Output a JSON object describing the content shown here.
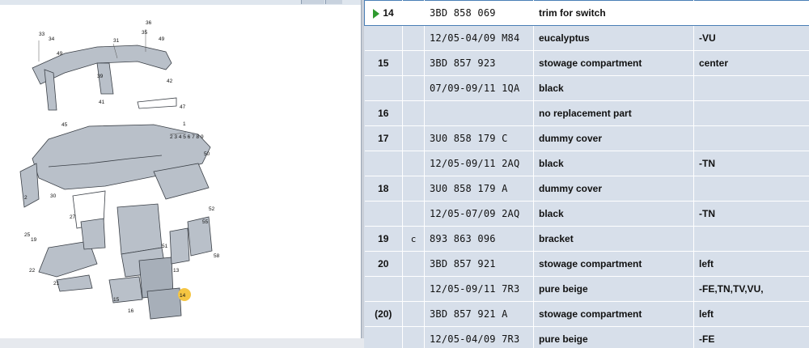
{
  "diagram": {
    "callout_labels": [
      "1",
      "2 3 4 5 6 7 8 9",
      "4",
      "5",
      "6",
      "7",
      "8",
      "9",
      "10",
      "11",
      "12",
      "13",
      "15",
      "16",
      "17",
      "19",
      "21",
      "22",
      "23",
      "24",
      "25",
      "26",
      "27",
      "28",
      "29",
      "30",
      "31",
      "33",
      "34",
      "35",
      "36",
      "37",
      "38",
      "40",
      "41",
      "42",
      "43",
      "44",
      "45",
      "46",
      "47",
      "48",
      "49",
      "50",
      "51",
      "52",
      "53",
      "54",
      "55",
      "56",
      "57",
      "58",
      "59",
      "60"
    ],
    "highlight_label": "14",
    "highlight_color": "#f5c542"
  },
  "table": {
    "rows": [
      {
        "pos": "14",
        "ind": "",
        "part": "3BD  858  069",
        "desc": "trim for switch",
        "remark": "",
        "selected": true
      },
      {
        "pos": "",
        "ind": "",
        "part": "12/05-04/09 M84",
        "desc": "eucalyptus",
        "remark": "-VU"
      },
      {
        "pos": "15",
        "ind": "",
        "part": "3BD  857  923",
        "desc": "stowage compartment",
        "remark": "center"
      },
      {
        "pos": "",
        "ind": "",
        "part": "07/09-09/11 1QA",
        "desc": "black",
        "remark": ""
      },
      {
        "pos": "16",
        "ind": "",
        "part": "",
        "desc": "no replacement part",
        "remark": ""
      },
      {
        "pos": "17",
        "ind": "",
        "part": "3U0  858  179  C",
        "desc": "dummy cover",
        "remark": ""
      },
      {
        "pos": "",
        "ind": "",
        "part": "12/05-09/11 2AQ",
        "desc": "black",
        "remark": "-TN"
      },
      {
        "pos": "18",
        "ind": "",
        "part": "3U0  858  179  A",
        "desc": "dummy cover",
        "remark": ""
      },
      {
        "pos": "",
        "ind": "",
        "part": "12/05-07/09 2AQ",
        "desc": "black",
        "remark": "-TN"
      },
      {
        "pos": "19",
        "ind": "c",
        "part": "893  863  096",
        "desc": "bracket",
        "remark": ""
      },
      {
        "pos": "20",
        "ind": "",
        "part": "3BD  857  921",
        "desc": "stowage compartment",
        "remark": "left"
      },
      {
        "pos": "",
        "ind": "",
        "part": "12/05-09/11 7R3",
        "desc": "pure beige",
        "remark": "-FE,TN,TV,VU,"
      },
      {
        "pos": "(20)",
        "ind": "",
        "part": "3BD  857  921  A",
        "desc": "stowage compartment",
        "remark": "left"
      },
      {
        "pos": "",
        "ind": "",
        "part": "12/05-04/09 7R3",
        "desc": "pure beige",
        "remark": "-FE"
      }
    ]
  },
  "colors": {
    "table_bg": "#d7dfea",
    "selection_border": "#4a7fb6",
    "arrow": "#2f9a2f"
  }
}
